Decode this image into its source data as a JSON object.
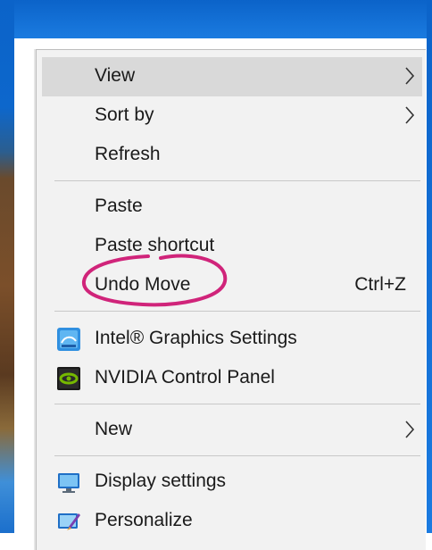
{
  "context_menu": {
    "view": {
      "label": "View",
      "icon": "chevron-right-icon"
    },
    "sort_by": {
      "label": "Sort by",
      "icon": "chevron-right-icon"
    },
    "refresh": {
      "label": "Refresh"
    },
    "paste": {
      "label": "Paste"
    },
    "paste_shortcut": {
      "label": "Paste shortcut"
    },
    "undo_move": {
      "label": "Undo Move",
      "shortcut": "Ctrl+Z"
    },
    "intel_graphics": {
      "label": "Intel® Graphics Settings",
      "icon": "intel-graphics-icon"
    },
    "nvidia_panel": {
      "label": "NVIDIA Control Panel",
      "icon": "nvidia-icon"
    },
    "new": {
      "label": "New",
      "icon": "chevron-right-icon"
    },
    "display_settings": {
      "label": "Display settings",
      "icon": "display-icon"
    },
    "personalize": {
      "label": "Personalize",
      "icon": "personalize-icon"
    }
  },
  "colors": {
    "desktop_blue": "#0b63c9",
    "menu_background": "#f2f2f2",
    "hover_background": "#d9d9d9",
    "annotation_pink": "#d0247a"
  }
}
